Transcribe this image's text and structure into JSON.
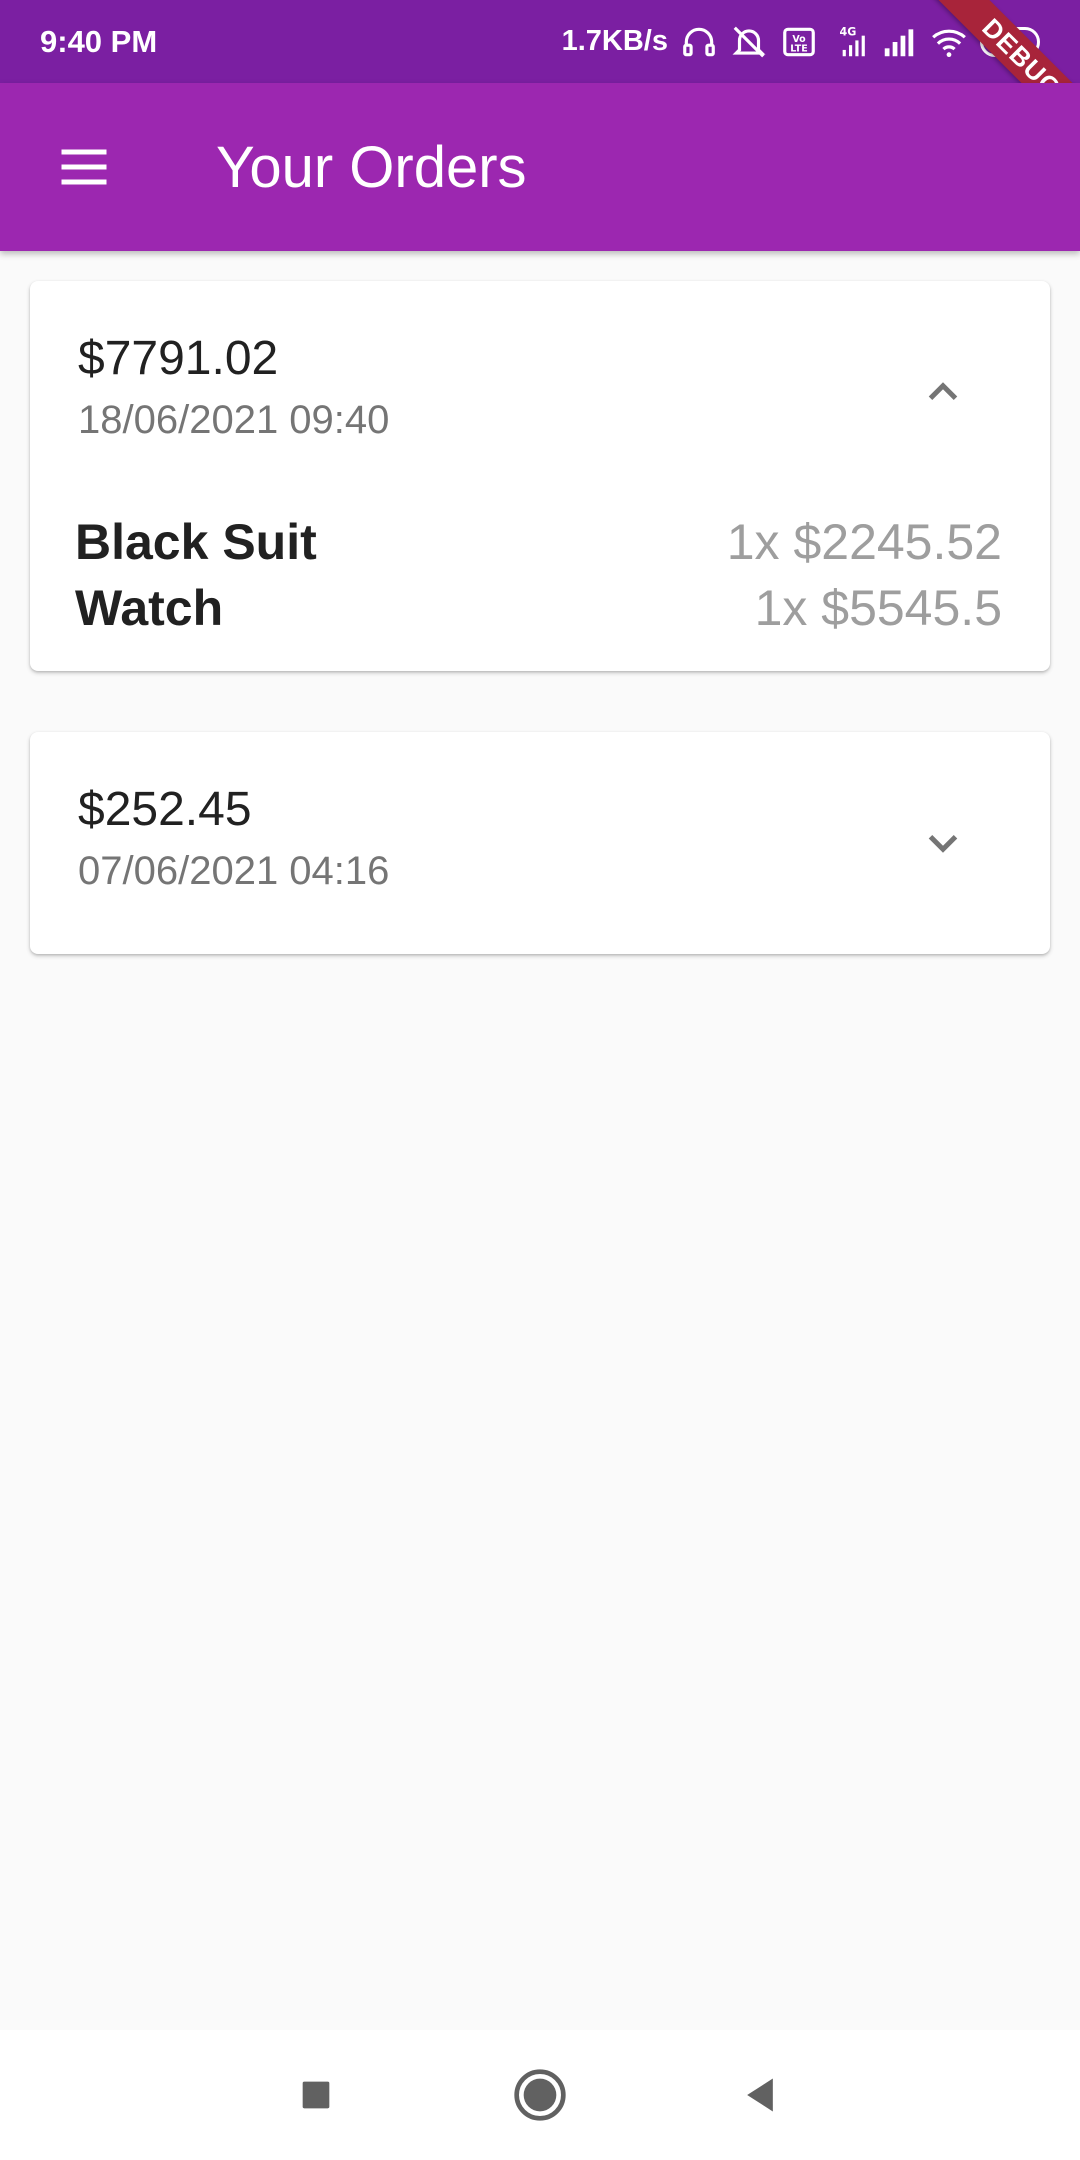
{
  "status_bar": {
    "time": "9:40 PM",
    "network_speed": "1.7KB/s",
    "battery": "54",
    "icons": [
      "headphones-icon",
      "muted-bell-icon",
      "volte-icon",
      "signal-4g-icon",
      "signal-icon",
      "wifi-icon",
      "battery-icon"
    ]
  },
  "debug_banner": "DEBUG",
  "app_bar": {
    "title": "Your Orders",
    "menu_icon": "hamburger-menu-icon",
    "background": "#9c27b0"
  },
  "orders": [
    {
      "total": "$7791.02",
      "date": "18/06/2021 09:40",
      "expanded": true,
      "toggle_icon": "chevron-up-icon",
      "items": [
        {
          "name": "Black Suit",
          "qty_price": "1x $2245.52"
        },
        {
          "name": "Watch",
          "qty_price": "1x $5545.5"
        }
      ]
    },
    {
      "total": "$252.45",
      "date": "07/06/2021 04:16",
      "expanded": false,
      "toggle_icon": "chevron-down-icon",
      "items": []
    }
  ],
  "nav_bar": {
    "icons": [
      "recents-icon",
      "home-icon",
      "back-icon"
    ]
  }
}
